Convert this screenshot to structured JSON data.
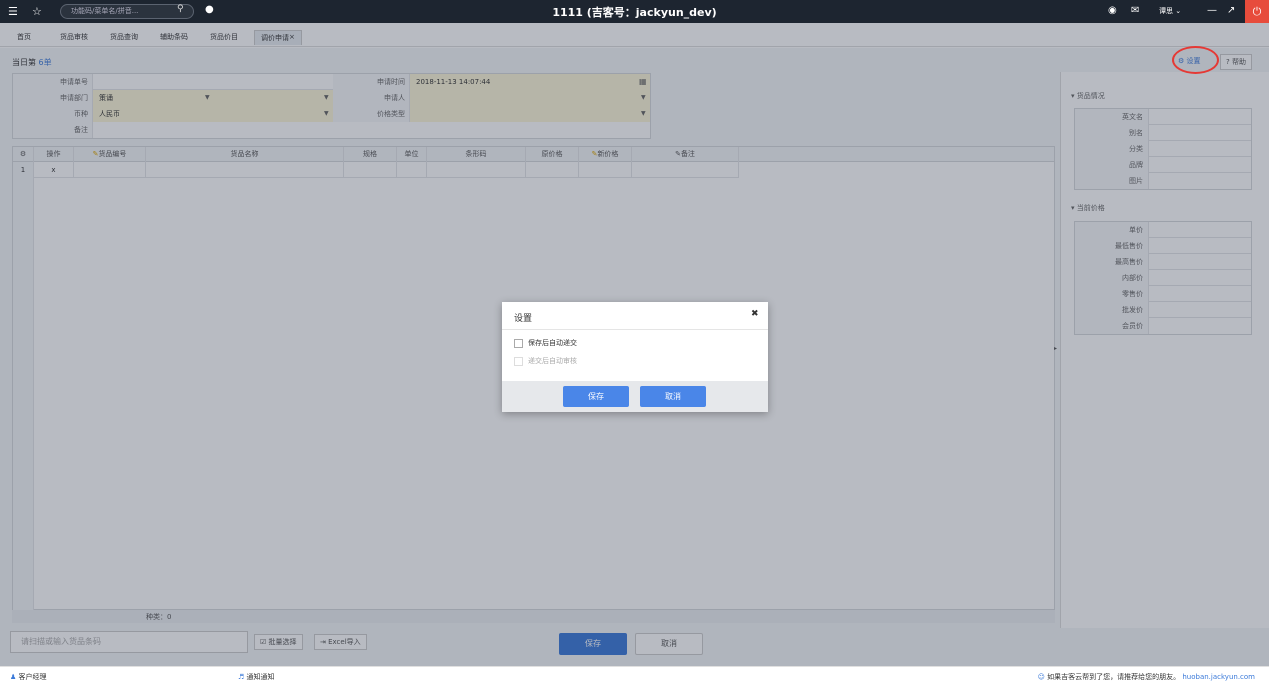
{
  "window": {
    "title": "1111  (吉客号：jackyun_dev)",
    "search_placeholder": "功能码/菜单名/拼音...",
    "user_name": "谭思"
  },
  "tabs": [
    {
      "label": "首页"
    },
    {
      "label": "货品审核"
    },
    {
      "label": "货品查询"
    },
    {
      "label": "辅助条码"
    },
    {
      "label": "货品价目"
    },
    {
      "label": "调价申请",
      "active": true
    }
  ],
  "page": {
    "title_prefix": "当日第",
    "title_count": "6单",
    "settings_label": "设置",
    "help_label": "帮助"
  },
  "form": {
    "request_no_label": "申请单号",
    "request_no_value": "",
    "request_time_label": "申请时间",
    "request_time_value": "2018-11-13 14:07:44",
    "department_label": "申请部门",
    "department_value": "策诵",
    "applicant_label": "申请人",
    "applicant_value": "",
    "currency_label": "币种",
    "currency_value": "人民币",
    "price_type_label": "价格类型",
    "price_type_value": "",
    "remark_label": "备注",
    "remark_value": ""
  },
  "table": {
    "columns": [
      "操作",
      "货品编号",
      "货品名称",
      "规格",
      "单位",
      "条形码",
      "原价格",
      "新价格",
      "备注"
    ],
    "rows": [
      {
        "num": "1",
        "op": "x"
      }
    ],
    "summary": "种类：0"
  },
  "bottom": {
    "scan_placeholder": "请扫描或输入货品条码",
    "batch_select": "批量选择",
    "excel_import": "Excel导入",
    "save": "保存",
    "cancel": "取消"
  },
  "right_panel": {
    "goods_section": "货品情况",
    "goods_fields": [
      "英文名",
      "别名",
      "分类",
      "品牌",
      "图片"
    ],
    "price_section": "当前价格",
    "price_fields": [
      "单价",
      "最低售价",
      "最高售价",
      "内部价",
      "零售价",
      "批发价",
      "会员价"
    ]
  },
  "dialog": {
    "title": "设置",
    "option1": "保存后自动递交",
    "option2": "递交后自动审核",
    "save": "保存",
    "cancel": "取消"
  },
  "statusbar": {
    "account_manager": "客户经理",
    "notice": "通知通知",
    "promo_text": "如果吉客云帮到了您，请推荐给您的朋友。",
    "promo_link": "huoban.jackyun.com"
  }
}
